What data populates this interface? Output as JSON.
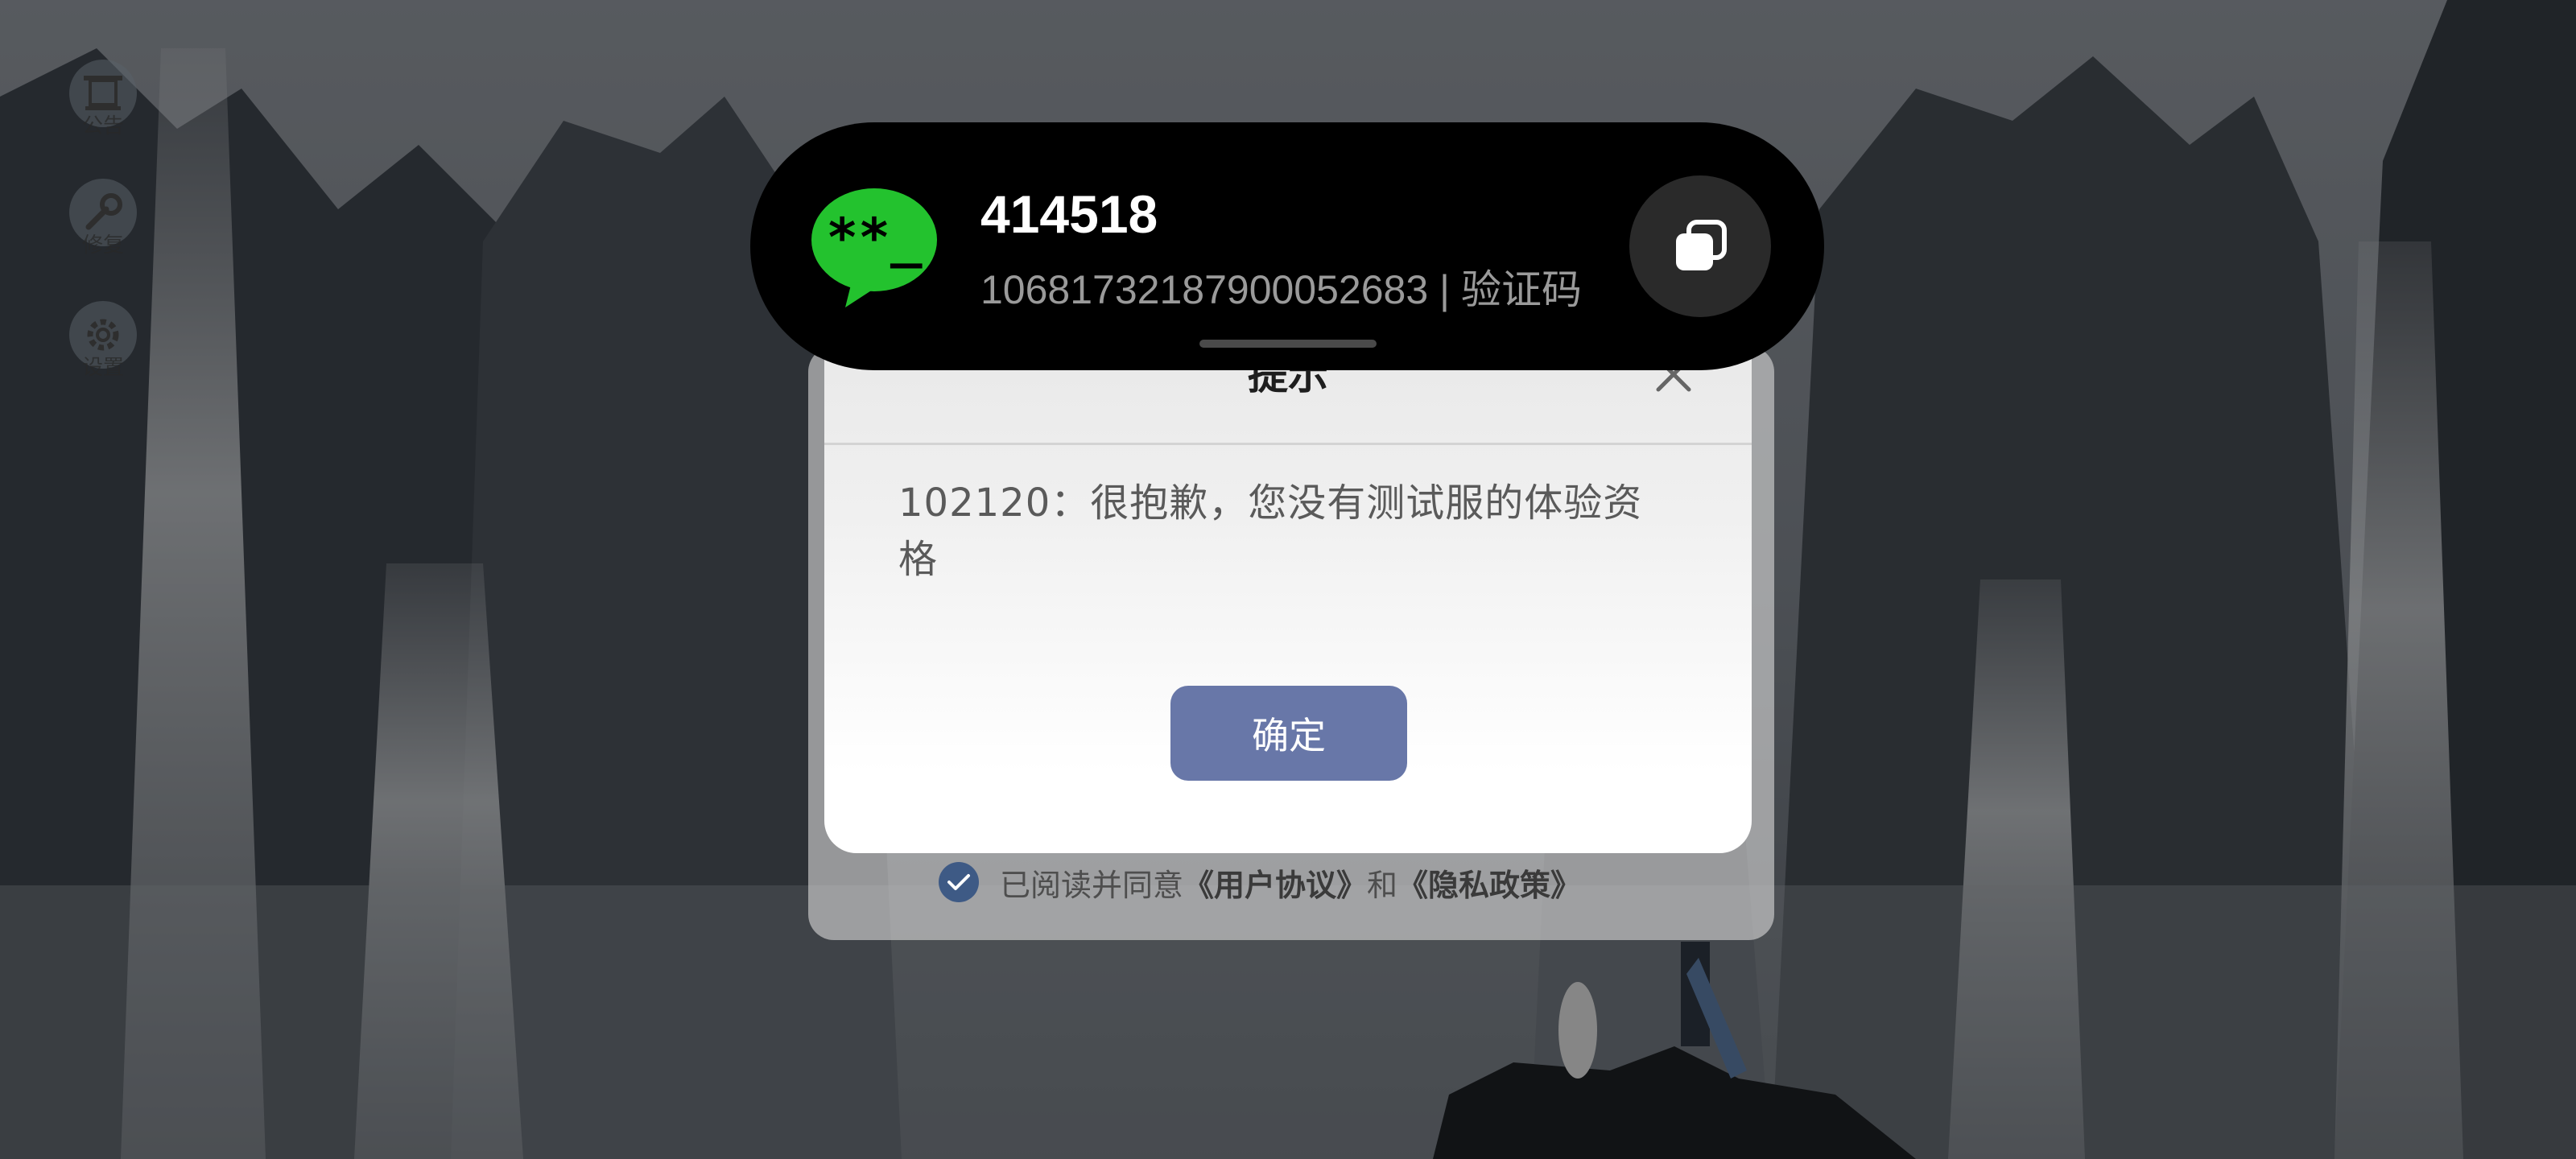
{
  "side_menu": {
    "items": [
      {
        "label": "公告",
        "icon": "gate-icon"
      },
      {
        "label": "修复",
        "icon": "wrench-icon"
      },
      {
        "label": "设置",
        "icon": "gear-icon"
      }
    ]
  },
  "sms_notification": {
    "code": "414518",
    "sender": "1068173218790005268",
    "separator": "3 | ",
    "category": "验证码",
    "app_icon": "message-bubble-icon",
    "copy_icon": "copy-icon",
    "icon_color": "#23c22e"
  },
  "dialog": {
    "title": "提示",
    "message": "102120：很抱歉，您没有测试服的体验资格",
    "confirm_label": "确定",
    "accent": "#6877a8"
  },
  "login_panel": {
    "agree_prefix": "已阅读并同意",
    "user_agreement": "《用户协议》",
    "and_word": "和",
    "privacy_policy": "《隐私政策》"
  }
}
